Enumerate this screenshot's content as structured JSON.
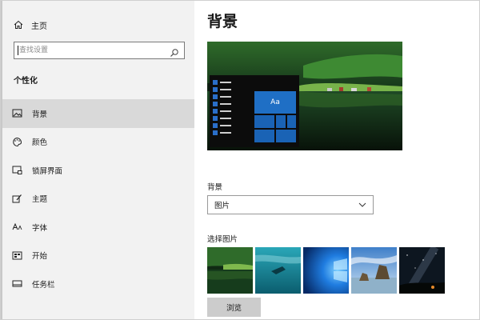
{
  "sidebar": {
    "home_label": "主页",
    "search_placeholder": "查找设置",
    "section_title": "个性化",
    "items": [
      {
        "label": "背景",
        "icon": "image-icon",
        "active": true
      },
      {
        "label": "颜色",
        "icon": "palette-icon",
        "active": false
      },
      {
        "label": "锁屏界面",
        "icon": "lock-screen-icon",
        "active": false
      },
      {
        "label": "主题",
        "icon": "theme-icon",
        "active": false
      },
      {
        "label": "字体",
        "icon": "font-icon",
        "active": false
      },
      {
        "label": "开始",
        "icon": "start-icon",
        "active": false
      },
      {
        "label": "任务栏",
        "icon": "taskbar-icon",
        "active": false
      }
    ]
  },
  "main": {
    "title": "背景",
    "preview_tile_text": "Aa",
    "background_label": "背景",
    "background_value": "图片",
    "choose_label": "选择图片",
    "browse_label": "浏览"
  },
  "colors": {
    "accent": "#1f6fc5",
    "sidebar_bg": "#f2f2f2",
    "active_item_bg": "#d9d9d9"
  }
}
